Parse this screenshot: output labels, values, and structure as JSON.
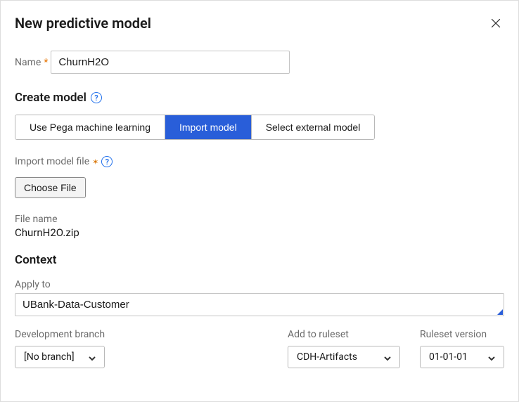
{
  "modal": {
    "title": "New predictive model"
  },
  "name": {
    "label": "Name",
    "value": "ChurnH2O"
  },
  "create_model": {
    "title": "Create model",
    "options": [
      "Use Pega machine learning",
      "Import model",
      "Select external model"
    ]
  },
  "import_file": {
    "label": "Import model file",
    "button": "Choose File",
    "file_name_label": "File name",
    "file_name_value": "ChurnH2O.zip"
  },
  "context": {
    "title": "Context",
    "apply_to": {
      "label": "Apply to",
      "value": "UBank-Data-Customer"
    }
  },
  "bottom": {
    "dev_branch": {
      "label": "Development branch",
      "value": "[No branch]"
    },
    "ruleset": {
      "label": "Add to ruleset",
      "value": "CDH-Artifacts"
    },
    "ruleset_version": {
      "label": "Ruleset version",
      "value": "01-01-01"
    }
  }
}
